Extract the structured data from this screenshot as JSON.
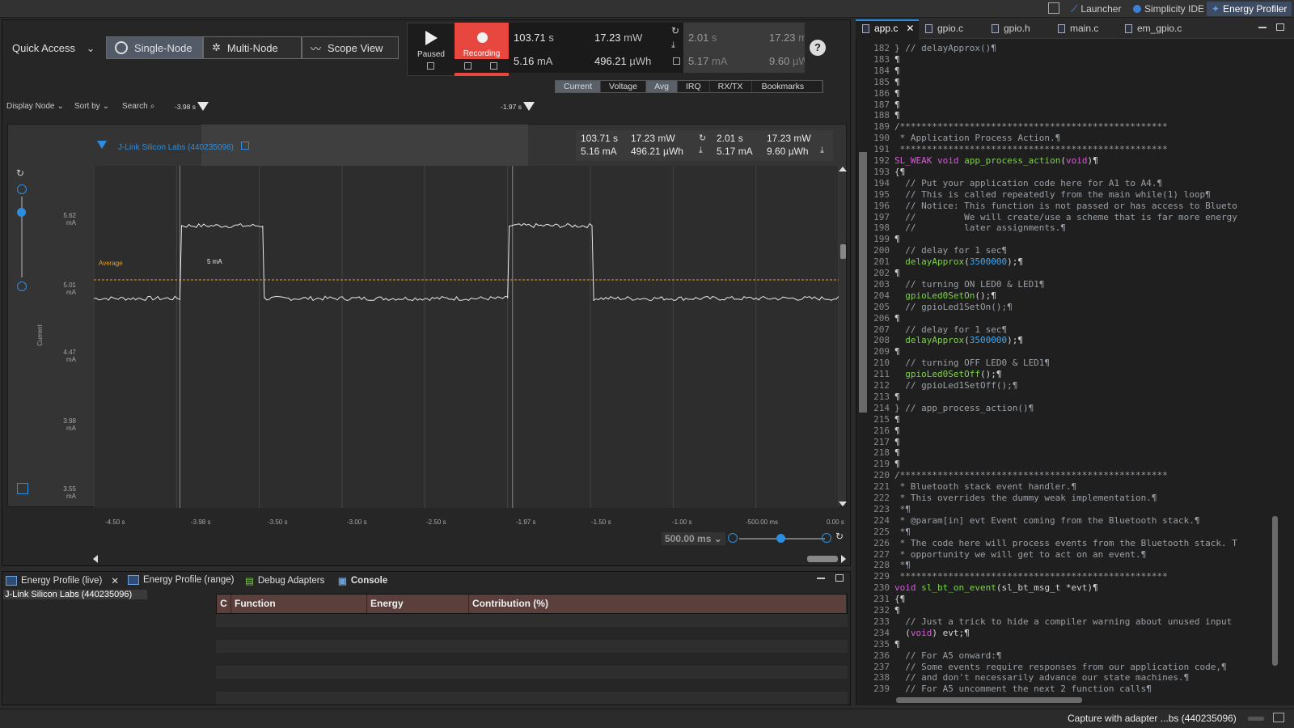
{
  "top_bar": {
    "perspectives": [
      "Launcher",
      "Simplicity IDE",
      "Energy Profiler"
    ],
    "active": "Energy Profiler"
  },
  "profiler": {
    "quick_access_label": "Quick Access",
    "modes": [
      "Single-Node",
      "Multi-Node",
      "Scope View"
    ],
    "active_mode": "Single-Node",
    "play_label": "Paused",
    "record_label": "Recording",
    "metrics": {
      "time": "103.71",
      "time_unit": "s",
      "current": "5.16",
      "current_unit": "mA",
      "power": "17.23",
      "power_unit": "mW",
      "energy": "496.21",
      "energy_unit": "µWh",
      "range_time": "2.01",
      "range_time_unit": "s",
      "range_current": "5.17",
      "range_current_unit": "mA",
      "range_power": "17.23",
      "range_power_unit": "mW",
      "range_energy": "9.60",
      "range_energy_unit": "µW"
    },
    "toolbar": {
      "display_node": "Display Node",
      "sort_by": "Sort by",
      "search": "Search"
    },
    "view_tabs": [
      "Current",
      "Voltage",
      "Avg",
      "IRQ",
      "RX/TX",
      "Bookmarks"
    ],
    "active_view_tabs": [
      "Current",
      "Avg"
    ],
    "cursors": [
      "-3.98 s",
      "-1.97 s"
    ],
    "node_label": "J-Link Silicon Labs (440235096)",
    "plot_stats": {
      "time": "103.71 s",
      "current": "5.16 mA",
      "power": "17.23 mW",
      "energy": "496.21 µWh",
      "range_time": "2.01 s",
      "range_current": "5.17 mA",
      "range_power": "17.23 mW",
      "range_energy": "9.60 µWh"
    },
    "average_label": "Average",
    "avg_value_label": "5 mA",
    "y_axis_title": "Current",
    "zoom_label": "500.00 ms"
  },
  "chart_data": {
    "type": "line",
    "title": "",
    "xlabel": "",
    "ylabel": "Current",
    "y_ticks": [
      "5.62 mA",
      "5.01 mA",
      "4.47 mA",
      "3.98 mA",
      "3.55 mA"
    ],
    "x_ticks": [
      "-4.50 s",
      "-3.98 s",
      "-3.50 s",
      "-3.00 s",
      "-2.50 s",
      "-1.97 s",
      "-1.50 s",
      "-1.00 s",
      "-500.00 ms",
      "0.00 s"
    ],
    "xlim": [
      -4.5,
      0
    ],
    "ylim": [
      3.45,
      5.85
    ],
    "average_mA": 5.05,
    "series": [
      {
        "name": "Current",
        "x": [
          -4.5,
          -3.98,
          -3.97,
          -3.48,
          -3.47,
          -2.0,
          -1.99,
          -1.49,
          -1.48,
          0.0
        ],
        "y": [
          4.92,
          4.92,
          5.43,
          5.43,
          4.92,
          4.92,
          5.43,
          5.43,
          4.92,
          4.92
        ]
      }
    ]
  },
  "bottom": {
    "tabs": [
      "Energy Profile (live)",
      "Energy Profile (range)",
      "Debug Adapters",
      "Console"
    ],
    "node": "J-Link Silicon Labs (440235096)",
    "columns": [
      "C",
      "Function",
      "Energy",
      "Contribution (%)"
    ]
  },
  "editor": {
    "tabs": [
      "app.c",
      "gpio.c",
      "gpio.h",
      "main.c",
      "em_gpio.c"
    ],
    "active_tab": "app.c",
    "lines": [
      {
        "n": "182",
        "t": "} // delayApprox()¶"
      },
      {
        "n": "183",
        "t": "¶"
      },
      {
        "n": "184",
        "t": "¶"
      },
      {
        "n": "185",
        "t": "¶"
      },
      {
        "n": "186",
        "t": "¶"
      },
      {
        "n": "187",
        "t": "¶"
      },
      {
        "n": "188",
        "t": "¶"
      },
      {
        "n": "189",
        "t": "/**************************************************"
      },
      {
        "n": "190",
        "t": " * Application Process Action.¶"
      },
      {
        "n": "191",
        "t": " **************************************************"
      },
      {
        "n": "192",
        "t": "SL_WEAK void app_process_action(void)¶"
      },
      {
        "n": "193",
        "t": "{¶"
      },
      {
        "n": "194",
        "t": "  // Put your application code here for A1 to A4.¶"
      },
      {
        "n": "195",
        "t": "  // This is called repeatedly from the main while(1) loop¶"
      },
      {
        "n": "196",
        "t": "  // Notice: This function is not passed or has access to Blueto"
      },
      {
        "n": "197",
        "t": "  //         We will create/use a scheme that is far more energy"
      },
      {
        "n": "198",
        "t": "  //         later assignments.¶"
      },
      {
        "n": "199",
        "t": "¶"
      },
      {
        "n": "200",
        "t": "  // delay for 1 sec¶"
      },
      {
        "n": "201",
        "t": "  delayApprox(3500000);¶"
      },
      {
        "n": "202",
        "t": "¶"
      },
      {
        "n": "203",
        "t": "  // turning ON LED0 & LED1¶"
      },
      {
        "n": "204",
        "t": "  gpioLed0SetOn();¶"
      },
      {
        "n": "205",
        "t": "  // gpioLed1SetOn();¶"
      },
      {
        "n": "206",
        "t": "¶"
      },
      {
        "n": "207",
        "t": "  // delay for 1 sec¶"
      },
      {
        "n": "208",
        "t": "  delayApprox(3500000);¶"
      },
      {
        "n": "209",
        "t": "¶"
      },
      {
        "n": "210",
        "t": "  // turning OFF LED0 & LED1¶"
      },
      {
        "n": "211",
        "t": "  gpioLed0SetOff();¶"
      },
      {
        "n": "212",
        "t": "  // gpioLed1SetOff();¶"
      },
      {
        "n": "213",
        "t": "¶"
      },
      {
        "n": "214",
        "t": "} // app_process_action()¶"
      },
      {
        "n": "215",
        "t": "¶"
      },
      {
        "n": "216",
        "t": "¶"
      },
      {
        "n": "217",
        "t": "¶"
      },
      {
        "n": "218",
        "t": "¶"
      },
      {
        "n": "219",
        "t": "¶"
      },
      {
        "n": "220",
        "t": "/**************************************************"
      },
      {
        "n": "221",
        "t": " * Bluetooth stack event handler.¶"
      },
      {
        "n": "222",
        "t": " * This overrides the dummy weak implementation.¶"
      },
      {
        "n": "223",
        "t": " *¶"
      },
      {
        "n": "224",
        "t": " * @param[in] evt Event coming from the Bluetooth stack.¶"
      },
      {
        "n": "225",
        "t": " *¶"
      },
      {
        "n": "226",
        "t": " * The code here will process events from the Bluetooth stack. T"
      },
      {
        "n": "227",
        "t": " * opportunity we will get to act on an event.¶"
      },
      {
        "n": "228",
        "t": " *¶"
      },
      {
        "n": "229",
        "t": " **************************************************"
      },
      {
        "n": "230",
        "t": "void sl_bt_on_event(sl_bt_msg_t *evt)¶"
      },
      {
        "n": "231",
        "t": "{¶"
      },
      {
        "n": "232",
        "t": "¶"
      },
      {
        "n": "233",
        "t": "  // Just a trick to hide a compiler warning about unused input"
      },
      {
        "n": "234",
        "t": "  (void) evt;¶"
      },
      {
        "n": "235",
        "t": "¶"
      },
      {
        "n": "236",
        "t": "  // For A5 onward:¶"
      },
      {
        "n": "237",
        "t": "  // Some events require responses from our application code,¶"
      },
      {
        "n": "238",
        "t": "  // and don't necessarily advance our state machines.¶"
      },
      {
        "n": "239",
        "t": "  // For A5 uncomment the next 2 function calls¶"
      }
    ]
  },
  "status": {
    "capture": "Capture with adapter ...bs (440235096)"
  },
  "colors": {
    "record_red": "#e8473f",
    "trace": "#e8e8e8",
    "average_line": "#e6a020",
    "accent_blue": "#2d8de0"
  }
}
